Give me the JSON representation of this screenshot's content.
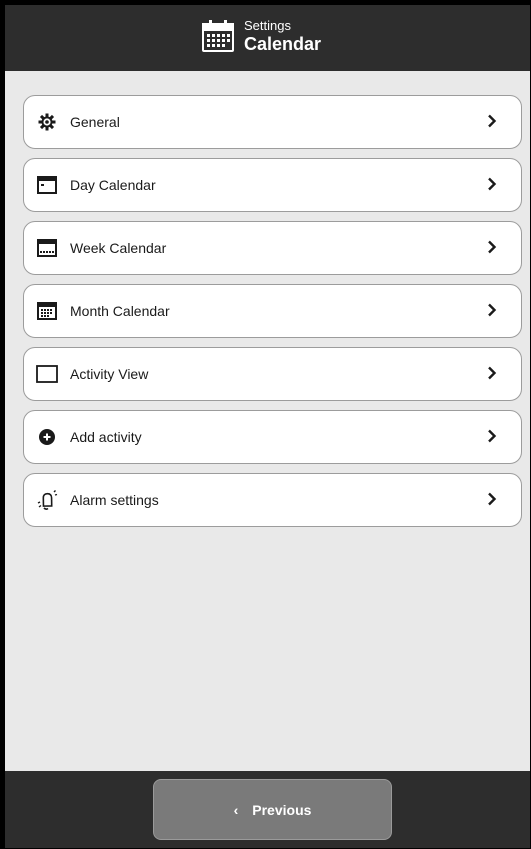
{
  "header": {
    "subtitle": "Settings",
    "title": "Calendar",
    "icon": "calendar-icon"
  },
  "menu": {
    "items": [
      {
        "label": "General",
        "icon": "gear-icon"
      },
      {
        "label": "Day Calendar",
        "icon": "day-calendar-icon"
      },
      {
        "label": "Week Calendar",
        "icon": "week-calendar-icon"
      },
      {
        "label": "Month Calendar",
        "icon": "month-calendar-icon"
      },
      {
        "label": "Activity View",
        "icon": "activity-view-icon"
      },
      {
        "label": "Add activity",
        "icon": "add-circle-icon"
      },
      {
        "label": "Alarm settings",
        "icon": "alarm-bell-icon"
      }
    ]
  },
  "footer": {
    "previous_label": "Previous"
  },
  "colors": {
    "bar_background": "#2d2d2d",
    "page_background": "#e9e9e9",
    "button_background": "#7a7a7a"
  }
}
